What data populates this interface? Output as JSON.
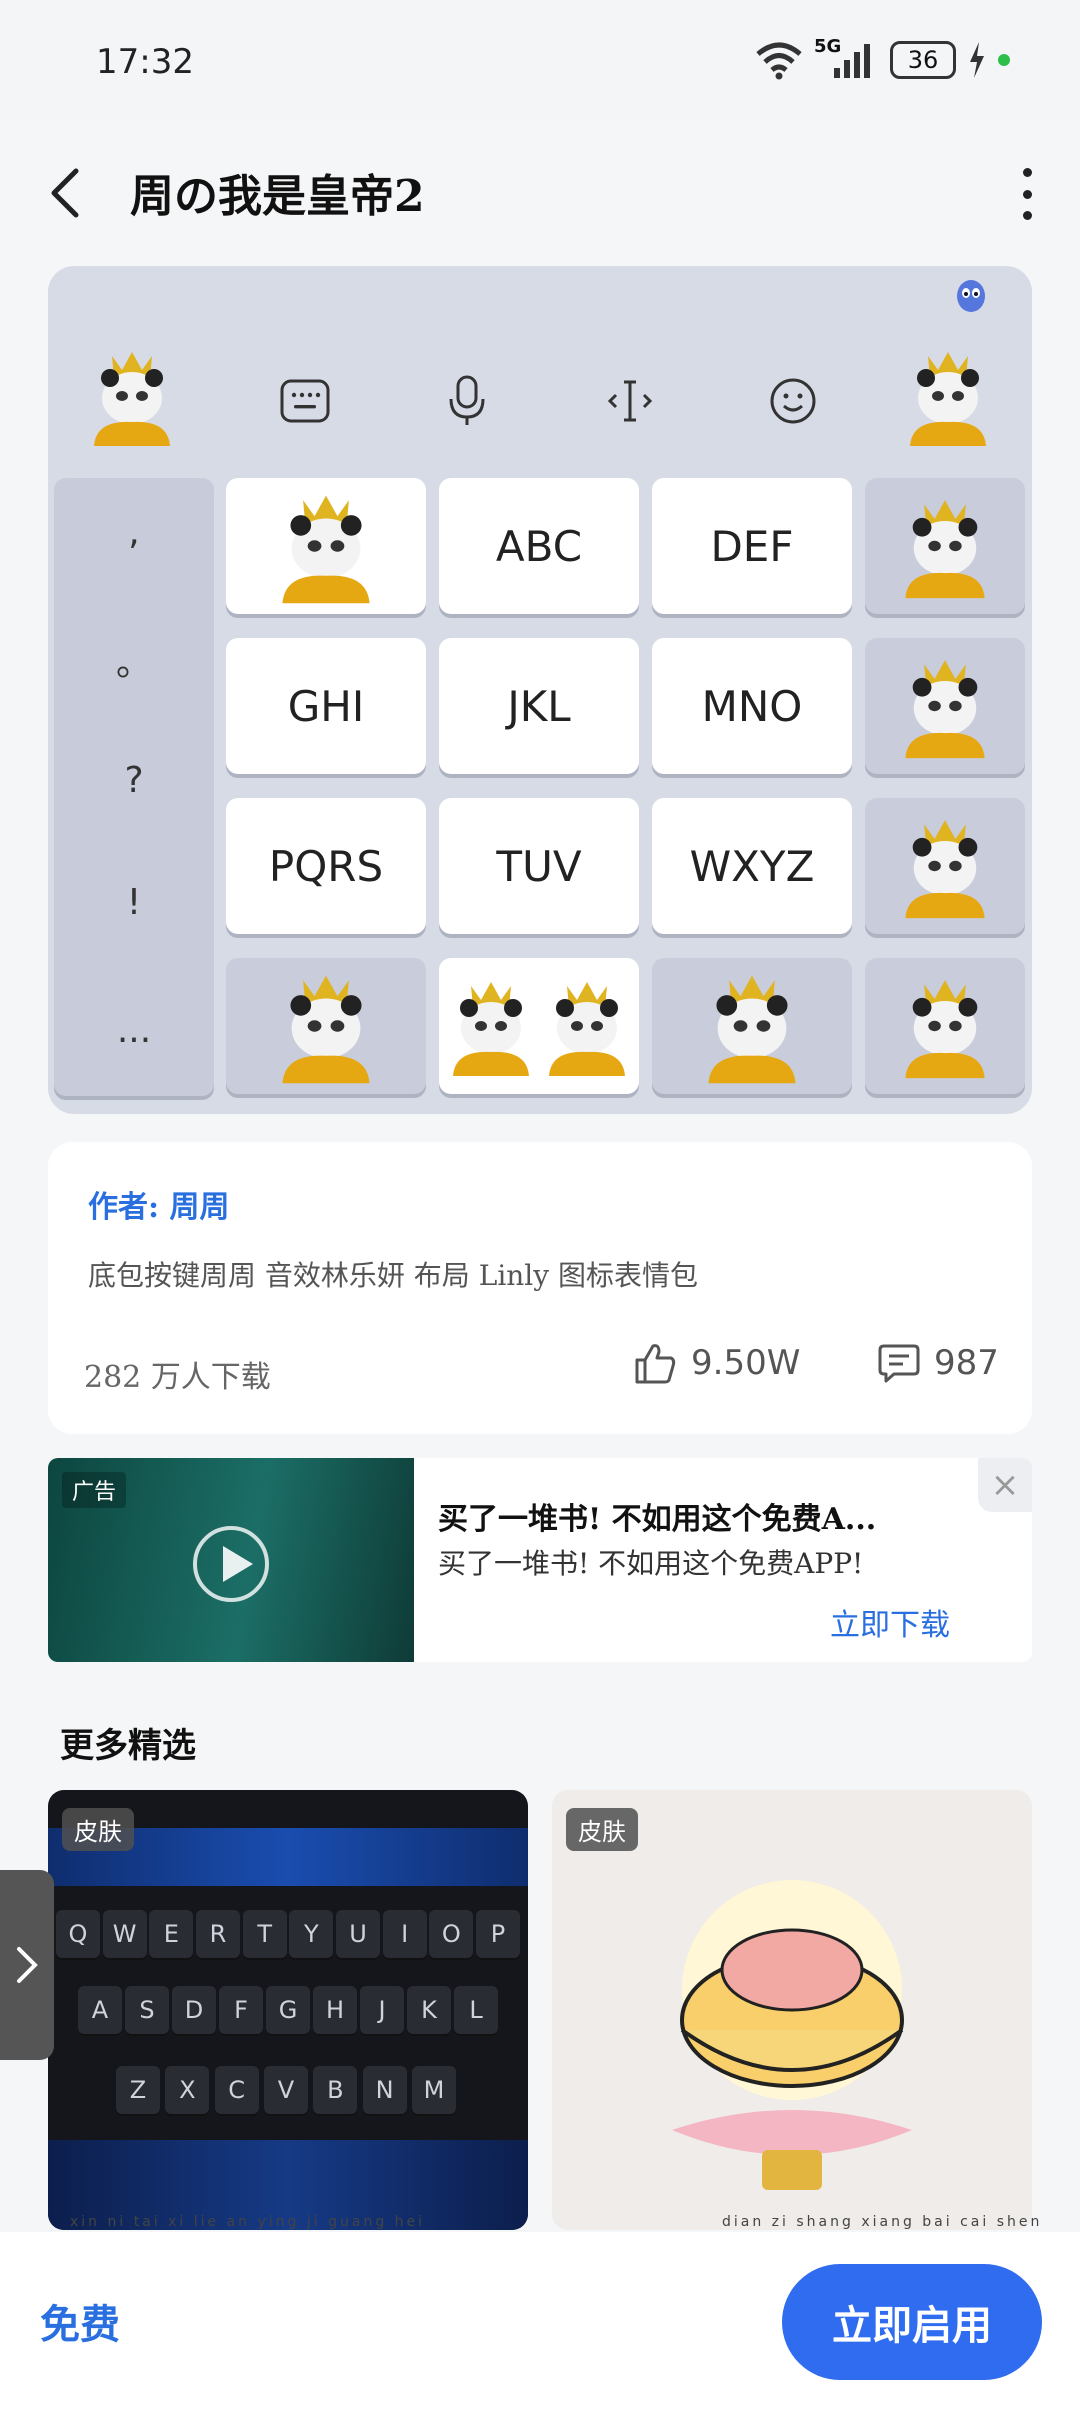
{
  "status_bar": {
    "time": "17:32",
    "network": "5G",
    "battery": "36"
  },
  "header": {
    "title": "周の我是皇帝2"
  },
  "keyboard_preview": {
    "symbols": [
      ",",
      "。",
      "?",
      "!",
      "..."
    ],
    "keys": [
      "ABC",
      "DEF",
      "GHI",
      "JKL",
      "MNO",
      "PQRS",
      "TUV",
      "WXYZ"
    ]
  },
  "info": {
    "author_label": "作者:",
    "author_name": "周周",
    "description_prefix": "底包按键周周 音效林乐妍 布局",
    "description_latin": "Linly",
    "description_suffix": "图标表情包",
    "downloads_number": "282",
    "downloads_unit": "万人下载",
    "likes": "9.50W",
    "comments": "987"
  },
  "ad": {
    "tag": "广告",
    "title": "买了一堆书! 不如用这个免费A...",
    "subtitle": "买了一堆书! 不如用这个免费APP!",
    "cta": "立即下载",
    "close": "×"
  },
  "more_section": {
    "title": "更多精选",
    "cards": [
      {
        "tag": "皮肤",
        "caption": "xin ni tai xi lie  an ying ji guang hei",
        "theme": "dark"
      },
      {
        "tag": "皮肤",
        "caption": "dian zi shang xiang bai cai shen",
        "theme": "light"
      }
    ]
  },
  "mini_keyboard": {
    "row1": [
      "Q",
      "W",
      "E",
      "R",
      "T",
      "Y",
      "U",
      "I",
      "O",
      "P"
    ],
    "row2": [
      "A",
      "S",
      "D",
      "F",
      "G",
      "H",
      "J",
      "K",
      "L"
    ],
    "row3": [
      "Z",
      "X",
      "C",
      "V",
      "B",
      "N",
      "M"
    ]
  },
  "bottom_bar": {
    "price_label": "免费",
    "enable_button": "立即启用"
  },
  "colors": {
    "accent": "#2f6cf0",
    "link": "#2a6fe0",
    "keyboard_bg": "#d7dbe6"
  }
}
